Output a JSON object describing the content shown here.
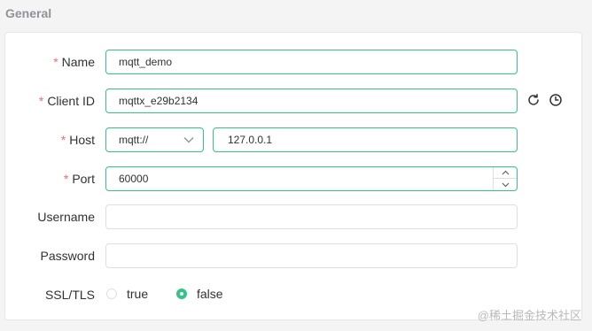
{
  "section": {
    "title": "General"
  },
  "form": {
    "name": {
      "required_mark": "*",
      "label": "Name",
      "value": "mqtt_demo"
    },
    "client_id": {
      "required_mark": "*",
      "label": "Client ID",
      "value": "mqttx_e29b2134"
    },
    "host": {
      "required_mark": "*",
      "label": "Host",
      "protocol": "mqtt://",
      "value": "127.0.0.1"
    },
    "port": {
      "required_mark": "*",
      "label": "Port",
      "value": "60000"
    },
    "username": {
      "label": "Username",
      "value": ""
    },
    "password": {
      "label": "Password",
      "value": ""
    },
    "ssl_tls": {
      "label": "SSL/TLS",
      "options": [
        {
          "label": "true",
          "selected": false
        },
        {
          "label": "false",
          "selected": true
        }
      ]
    }
  },
  "watermark": "@稀土掘金技术社区",
  "colors": {
    "accent": "#34c388",
    "required": "#f56c6c",
    "border": "#dcdfe6"
  },
  "icons": [
    "refresh-icon",
    "clock-icon",
    "chevron-down-icon",
    "chevron-up-icon"
  ]
}
